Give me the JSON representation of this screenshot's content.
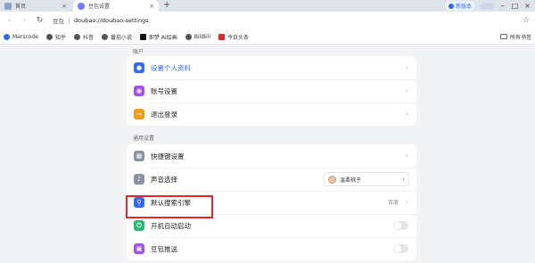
{
  "browser": {
    "tabs": [
      {
        "label": "首页",
        "icon": "home-icon"
      },
      {
        "label": "豆包设置",
        "icon": "doubao-icon"
      }
    ],
    "new_version_label": "新版本",
    "address": {
      "site_label": "豆包",
      "url": "doubao://doubao-settings"
    }
  },
  "bookmarks": [
    {
      "label": "Marscode",
      "icon": "marscode-icon",
      "color": "#2f6bf2"
    },
    {
      "label": "知乎",
      "icon": "globe-icon",
      "color": "#555555"
    },
    {
      "label": "抖音",
      "icon": "globe-icon",
      "color": "#555555"
    },
    {
      "label": "番茄小说",
      "icon": "globe-icon",
      "color": "#555555"
    },
    {
      "label": "即梦 AI绘画",
      "icon": "jimeng-icon",
      "color": "#111111"
    },
    {
      "label": "BiliBili",
      "icon": "globe-icon",
      "color": "#555555"
    },
    {
      "label": "今日头条",
      "icon": "toutiao-icon",
      "color": "#e5262c"
    }
  ],
  "bookmarks_all_label": "所有书签",
  "settings": {
    "account": {
      "title": "账户",
      "items": [
        {
          "label": "设置个人资料",
          "icon": "person-icon",
          "color": "#2f6bf2"
        },
        {
          "label": "账号设置",
          "icon": "account-icon",
          "color": "#a354e6"
        },
        {
          "label": "退出登录",
          "icon": "logout-icon",
          "color": "#f29a1c"
        }
      ]
    },
    "general": {
      "title": "通用设置",
      "items": [
        {
          "label": "快捷键设置",
          "icon": "keyboard-icon",
          "color": "#8a93a6"
        },
        {
          "label": "声音选择",
          "icon": "sound-icon",
          "color": "#8a93a6",
          "voice": "温柔桃子"
        },
        {
          "label": "默认搜索引擎",
          "icon": "search-icon",
          "color": "#2f6bf2",
          "value": "百度"
        },
        {
          "label": "开机自动启动",
          "icon": "power-icon",
          "color": "#2bb673",
          "toggle": false
        },
        {
          "label": "豆包推送",
          "icon": "push-icon",
          "color": "#a354e6",
          "toggle": false
        }
      ]
    }
  },
  "highlight_color": "#e5262c"
}
